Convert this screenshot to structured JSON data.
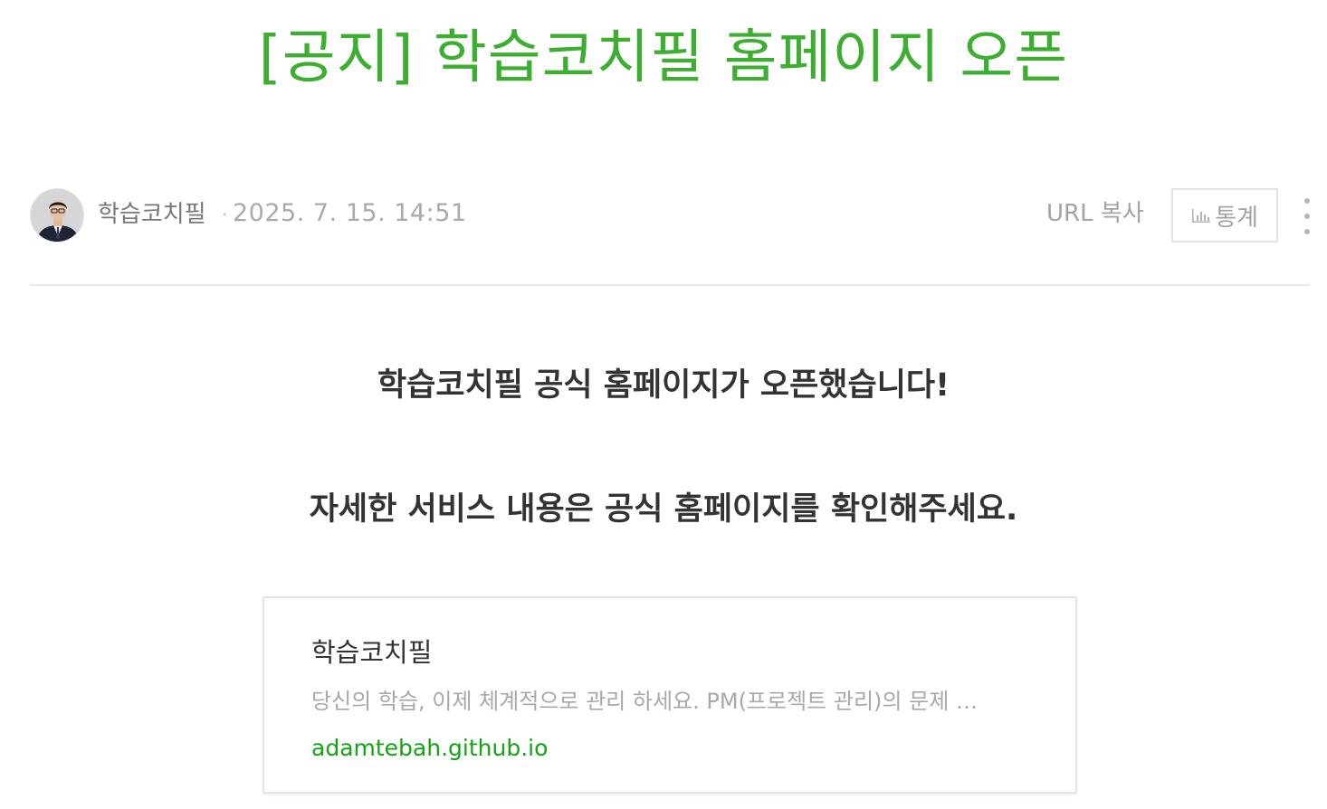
{
  "post": {
    "title": "[공지] 학습코치필 홈페이지 오픈"
  },
  "meta": {
    "author": "학습코치필",
    "separator": "·",
    "date": "2025. 7. 15. 14:51",
    "url_copy_label": "URL 복사",
    "stats_label": "통계"
  },
  "content": {
    "line1": "학습코치필 공식 홈페이지가 오픈했습니다!",
    "line2": "자세한 서비스 내용은 공식 홈페이지를 확인해주세요."
  },
  "link_card": {
    "title": "학습코치필",
    "description": "당신의 학습, 이제 체계적으로 관리 하세요. PM(프로젝트 관리)의 문제 …",
    "url": "adamtebah.github.io"
  },
  "colors": {
    "title_green": "#3cae30",
    "link_green": "#11a512",
    "muted_gray": "#a3a3a3"
  },
  "icons": {
    "stats": "bar-chart-icon",
    "more": "vertical-ellipsis-icon"
  }
}
